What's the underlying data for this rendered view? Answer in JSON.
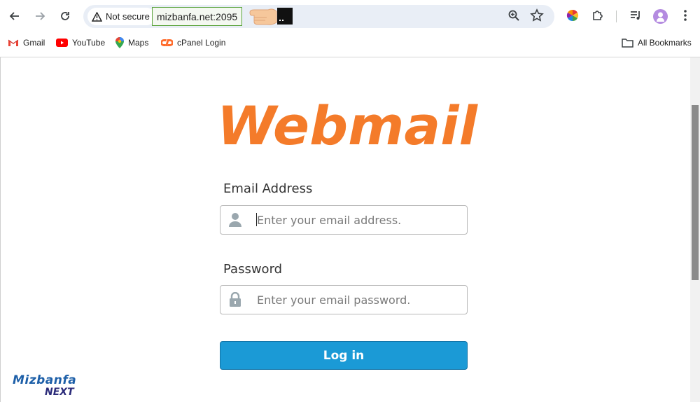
{
  "browser": {
    "security_label": "Not secure",
    "url": "mizbanfa.net:2095"
  },
  "bookmarks": {
    "items": [
      {
        "label": "Gmail",
        "icon": "gmail-icon"
      },
      {
        "label": "YouTube",
        "icon": "youtube-icon"
      },
      {
        "label": "Maps",
        "icon": "maps-icon"
      },
      {
        "label": "cPanel Login",
        "icon": "cpanel-icon"
      }
    ],
    "all_bookmarks": "All Bookmarks"
  },
  "page": {
    "logo_text": "Webmail",
    "email": {
      "label": "Email Address",
      "placeholder": "Enter your email address."
    },
    "password": {
      "label": "Password",
      "placeholder": "Enter your email password."
    },
    "login_label": "Log in"
  },
  "watermark": {
    "line1": "Mizbanfa",
    "line2": "NEXT"
  },
  "colors": {
    "logo_orange": "#f47b2a",
    "button_blue": "#1b9ad6",
    "url_highlight": "#5aa33b"
  }
}
